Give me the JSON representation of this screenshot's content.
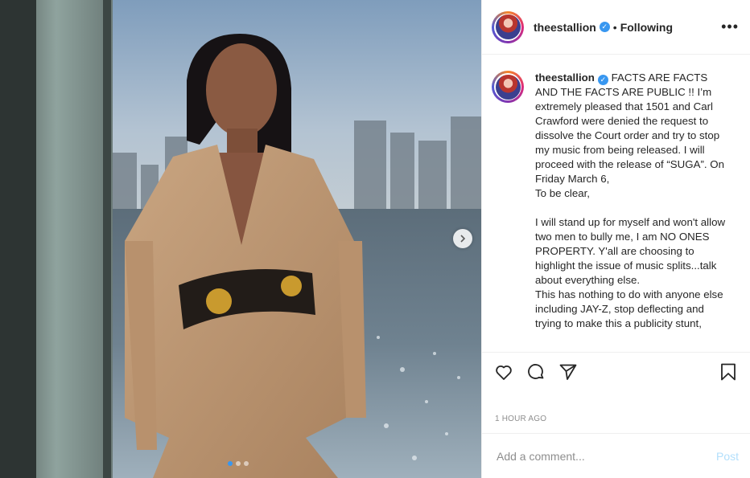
{
  "post": {
    "username": "theestallion",
    "verified_symbol": "✓",
    "separator": "•",
    "follow_status": "Following",
    "more_symbol": "•••",
    "caption": "FACTS ARE FACTS AND THE FACTS ARE PUBLIC !! I’m extremely pleased that 1501 and Carl Crawford were denied the request to dissolve the Court order and try to stop my music from being released. I will proceed with the release of “SUGA”. On Friday March 6,\nTo be clear,\n\nI will stand up for myself and won't allow two men to bully me, I am NO ONES PROPERTY. Y'all are choosing to highlight the issue of music splits...talk about everything else.\nThis has nothing to do with anyone else including JAY-Z, stop deflecting and trying to make this a publicity stunt,",
    "timestamp": "1 HOUR AGO",
    "comment_placeholder": "Add a comment...",
    "post_button": "Post"
  },
  "carousel": {
    "total_slides": 3,
    "active_slide": 1
  },
  "icons": {
    "like": "heart-icon",
    "comment": "comment-bubble-icon",
    "share": "paper-plane-icon",
    "save": "bookmark-icon",
    "next": "chevron-right-icon"
  },
  "colors": {
    "accent": "#3897f0",
    "post_button_disabled": "#b2dffc",
    "muted_text": "#8e8e8e",
    "border": "#efefef"
  }
}
